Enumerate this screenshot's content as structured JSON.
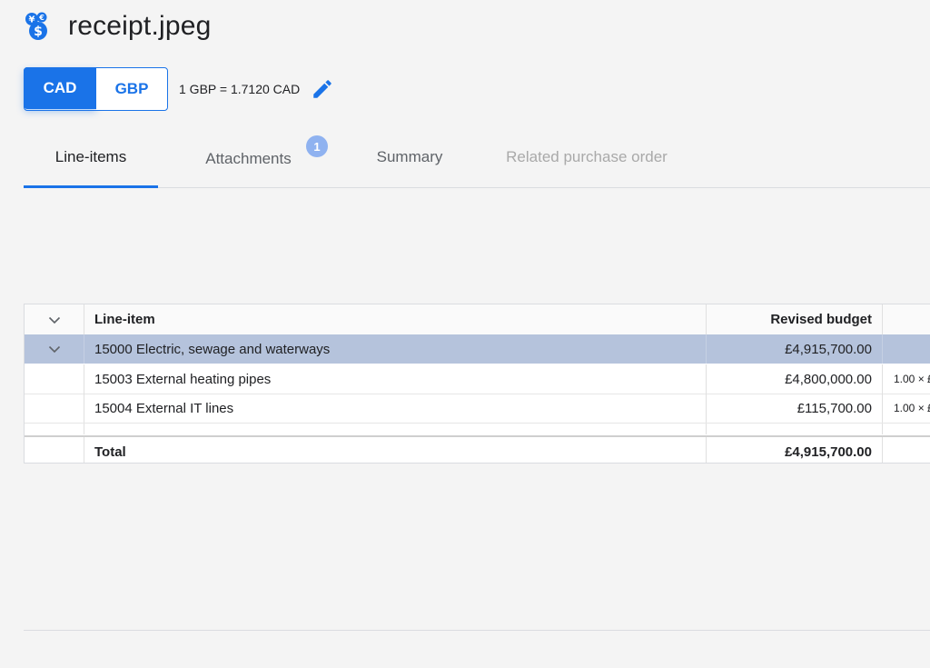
{
  "header": {
    "title": "receipt.jpeg",
    "icon": "currency-exchange-icon"
  },
  "currency": {
    "options": [
      "CAD",
      "GBP"
    ],
    "selected": "CAD",
    "rate_text": "1 GBP = 1.7120 CAD",
    "edit_icon": "pencil-icon"
  },
  "tabs": [
    {
      "label": "Line-items",
      "state": "active"
    },
    {
      "label": "Attachments",
      "state": "normal",
      "badge": "1"
    },
    {
      "label": "Summary",
      "state": "normal"
    },
    {
      "label": "Related purchase order",
      "state": "disabled"
    }
  ],
  "table": {
    "columns": [
      "Line-item",
      "Revised budget"
    ],
    "group": {
      "item": "15000 Electric, sewage and waterways",
      "budget": "£4,915,700.00"
    },
    "rows": [
      {
        "item": "15003 External heating pipes",
        "budget": "£4,800,000.00",
        "extra": "1.00 × £"
      },
      {
        "item": "15004 External IT lines",
        "budget": "£115,700.00",
        "extra": "1.00 × £"
      }
    ],
    "total": {
      "label": "Total",
      "budget": "£4,915,700.00"
    }
  },
  "colors": {
    "accent": "#1a73e8",
    "group_row": "#b5c3dc",
    "badge": "#8fb2f0"
  }
}
